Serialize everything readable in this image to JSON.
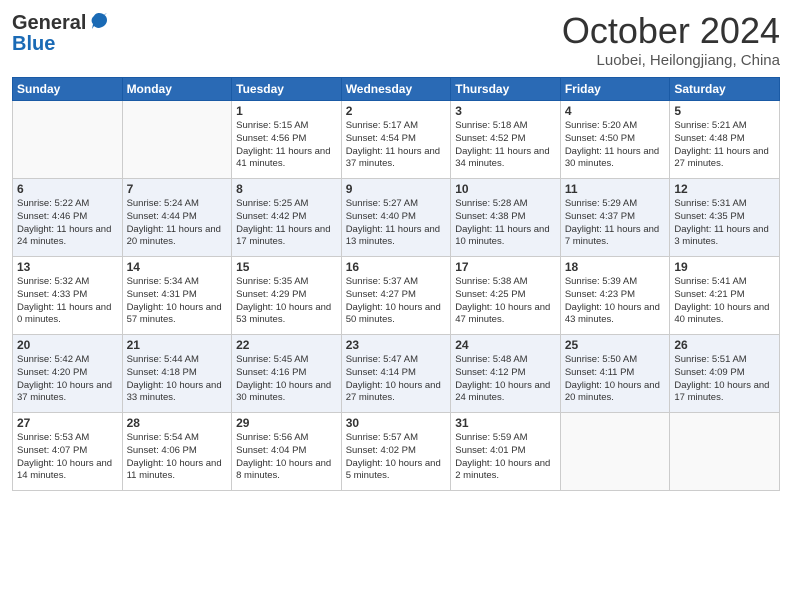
{
  "header": {
    "logo_general": "General",
    "logo_blue": "Blue",
    "month_title": "October 2024",
    "subtitle": "Luobei, Heilongjiang, China"
  },
  "weekdays": [
    "Sunday",
    "Monday",
    "Tuesday",
    "Wednesday",
    "Thursday",
    "Friday",
    "Saturday"
  ],
  "rows": [
    [
      {
        "day": "",
        "info": ""
      },
      {
        "day": "",
        "info": ""
      },
      {
        "day": "1",
        "info": "Sunrise: 5:15 AM\nSunset: 4:56 PM\nDaylight: 11 hours and 41 minutes."
      },
      {
        "day": "2",
        "info": "Sunrise: 5:17 AM\nSunset: 4:54 PM\nDaylight: 11 hours and 37 minutes."
      },
      {
        "day": "3",
        "info": "Sunrise: 5:18 AM\nSunset: 4:52 PM\nDaylight: 11 hours and 34 minutes."
      },
      {
        "day": "4",
        "info": "Sunrise: 5:20 AM\nSunset: 4:50 PM\nDaylight: 11 hours and 30 minutes."
      },
      {
        "day": "5",
        "info": "Sunrise: 5:21 AM\nSunset: 4:48 PM\nDaylight: 11 hours and 27 minutes."
      }
    ],
    [
      {
        "day": "6",
        "info": "Sunrise: 5:22 AM\nSunset: 4:46 PM\nDaylight: 11 hours and 24 minutes."
      },
      {
        "day": "7",
        "info": "Sunrise: 5:24 AM\nSunset: 4:44 PM\nDaylight: 11 hours and 20 minutes."
      },
      {
        "day": "8",
        "info": "Sunrise: 5:25 AM\nSunset: 4:42 PM\nDaylight: 11 hours and 17 minutes."
      },
      {
        "day": "9",
        "info": "Sunrise: 5:27 AM\nSunset: 4:40 PM\nDaylight: 11 hours and 13 minutes."
      },
      {
        "day": "10",
        "info": "Sunrise: 5:28 AM\nSunset: 4:38 PM\nDaylight: 11 hours and 10 minutes."
      },
      {
        "day": "11",
        "info": "Sunrise: 5:29 AM\nSunset: 4:37 PM\nDaylight: 11 hours and 7 minutes."
      },
      {
        "day": "12",
        "info": "Sunrise: 5:31 AM\nSunset: 4:35 PM\nDaylight: 11 hours and 3 minutes."
      }
    ],
    [
      {
        "day": "13",
        "info": "Sunrise: 5:32 AM\nSunset: 4:33 PM\nDaylight: 11 hours and 0 minutes."
      },
      {
        "day": "14",
        "info": "Sunrise: 5:34 AM\nSunset: 4:31 PM\nDaylight: 10 hours and 57 minutes."
      },
      {
        "day": "15",
        "info": "Sunrise: 5:35 AM\nSunset: 4:29 PM\nDaylight: 10 hours and 53 minutes."
      },
      {
        "day": "16",
        "info": "Sunrise: 5:37 AM\nSunset: 4:27 PM\nDaylight: 10 hours and 50 minutes."
      },
      {
        "day": "17",
        "info": "Sunrise: 5:38 AM\nSunset: 4:25 PM\nDaylight: 10 hours and 47 minutes."
      },
      {
        "day": "18",
        "info": "Sunrise: 5:39 AM\nSunset: 4:23 PM\nDaylight: 10 hours and 43 minutes."
      },
      {
        "day": "19",
        "info": "Sunrise: 5:41 AM\nSunset: 4:21 PM\nDaylight: 10 hours and 40 minutes."
      }
    ],
    [
      {
        "day": "20",
        "info": "Sunrise: 5:42 AM\nSunset: 4:20 PM\nDaylight: 10 hours and 37 minutes."
      },
      {
        "day": "21",
        "info": "Sunrise: 5:44 AM\nSunset: 4:18 PM\nDaylight: 10 hours and 33 minutes."
      },
      {
        "day": "22",
        "info": "Sunrise: 5:45 AM\nSunset: 4:16 PM\nDaylight: 10 hours and 30 minutes."
      },
      {
        "day": "23",
        "info": "Sunrise: 5:47 AM\nSunset: 4:14 PM\nDaylight: 10 hours and 27 minutes."
      },
      {
        "day": "24",
        "info": "Sunrise: 5:48 AM\nSunset: 4:12 PM\nDaylight: 10 hours and 24 minutes."
      },
      {
        "day": "25",
        "info": "Sunrise: 5:50 AM\nSunset: 4:11 PM\nDaylight: 10 hours and 20 minutes."
      },
      {
        "day": "26",
        "info": "Sunrise: 5:51 AM\nSunset: 4:09 PM\nDaylight: 10 hours and 17 minutes."
      }
    ],
    [
      {
        "day": "27",
        "info": "Sunrise: 5:53 AM\nSunset: 4:07 PM\nDaylight: 10 hours and 14 minutes."
      },
      {
        "day": "28",
        "info": "Sunrise: 5:54 AM\nSunset: 4:06 PM\nDaylight: 10 hours and 11 minutes."
      },
      {
        "day": "29",
        "info": "Sunrise: 5:56 AM\nSunset: 4:04 PM\nDaylight: 10 hours and 8 minutes."
      },
      {
        "day": "30",
        "info": "Sunrise: 5:57 AM\nSunset: 4:02 PM\nDaylight: 10 hours and 5 minutes."
      },
      {
        "day": "31",
        "info": "Sunrise: 5:59 AM\nSunset: 4:01 PM\nDaylight: 10 hours and 2 minutes."
      },
      {
        "day": "",
        "info": ""
      },
      {
        "day": "",
        "info": ""
      }
    ]
  ]
}
